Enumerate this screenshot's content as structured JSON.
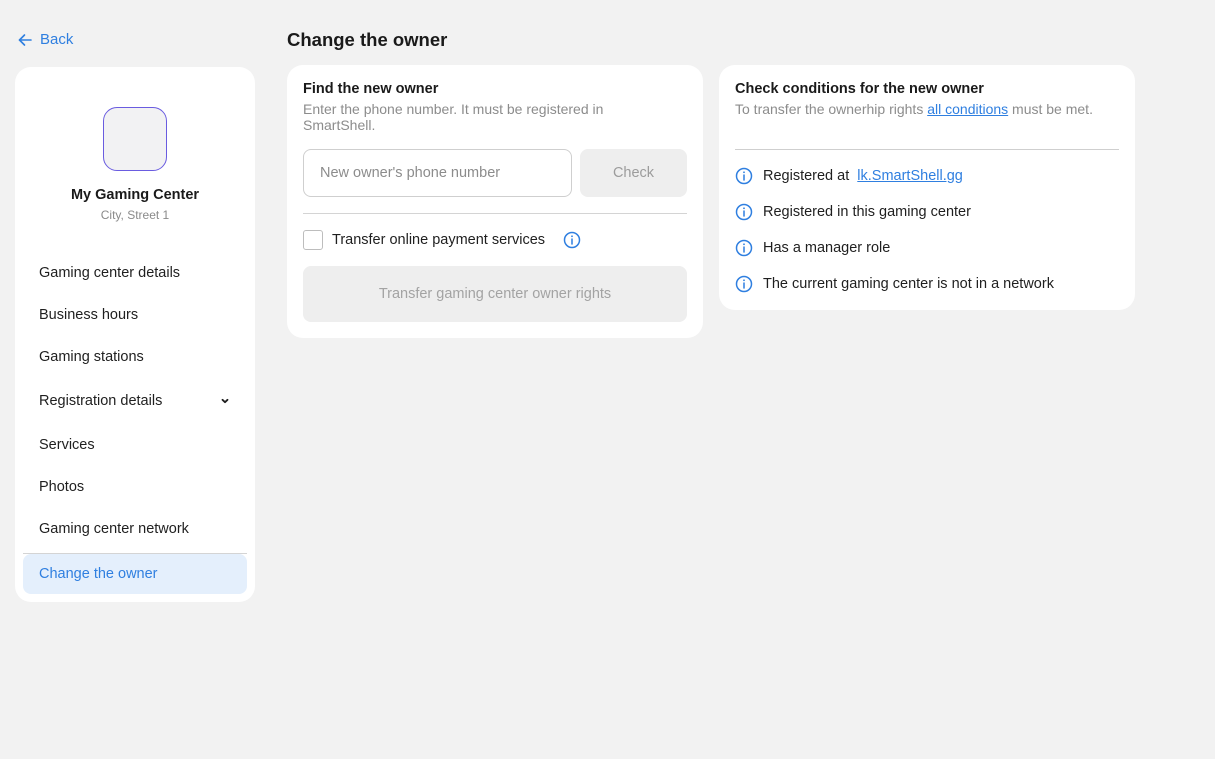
{
  "back": {
    "label": "Back"
  },
  "sidebar": {
    "center_name": "My Gaming Center",
    "center_address": "City, Street 1",
    "items": [
      {
        "label": "Gaming center details"
      },
      {
        "label": "Business hours"
      },
      {
        "label": "Gaming stations"
      },
      {
        "label": "Registration details"
      },
      {
        "label": "Services"
      },
      {
        "label": "Photos"
      },
      {
        "label": "Gaming center network"
      },
      {
        "label": "Change the owner"
      }
    ]
  },
  "page_title": "Change the owner",
  "find_card": {
    "title": "Find the new owner",
    "subtitle": "Enter the phone number. It must be registered in SmartShell.",
    "phone_placeholder": "New owner's phone number",
    "phone_value": "",
    "check_label": "Check",
    "checkbox_label": "Transfer online payment services",
    "checkbox_checked": false,
    "transfer_label": "Transfer gaming center owner rights"
  },
  "check_card": {
    "title": "Check conditions for the new owner",
    "subtitle_before": "To transfer the ownerhip rights ",
    "subtitle_link": "all conditions",
    "subtitle_after": " must be met.",
    "conditions": [
      {
        "text": "Registered at",
        "link": "lk.SmartShell.gg"
      },
      {
        "text": "Registered in this gaming center"
      },
      {
        "text": "Has a manager role"
      },
      {
        "text": "The current gaming center is not in a network"
      }
    ]
  },
  "colors": {
    "accent": "#2f7fe0",
    "avatar_border": "#6a5ce0",
    "active_bg": "#e4effc",
    "page_bg": "#f2f2f2"
  }
}
